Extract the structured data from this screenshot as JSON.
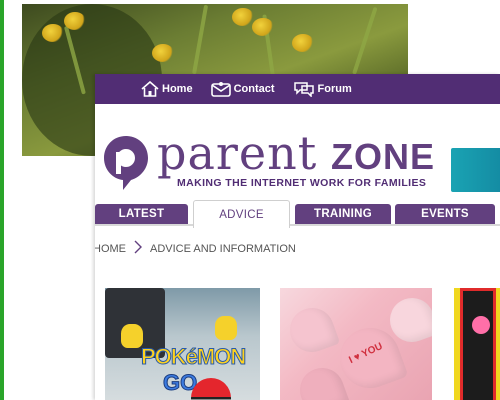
{
  "nav": {
    "home_label": "Home",
    "contact_label": "Contact",
    "forum_label": "Forum"
  },
  "brand": {
    "name_part1": "parent",
    "name_part2": "ZONE",
    "tagline": "MAKING THE INTERNET WORK FOR FAMILIES"
  },
  "tabs": [
    {
      "label": "LATEST",
      "active": false
    },
    {
      "label": "ADVICE",
      "active": true
    },
    {
      "label": "TRAINING",
      "active": false
    },
    {
      "label": "EVENTS",
      "active": false
    }
  ],
  "breadcrumb": {
    "items": [
      "HOME",
      "ADVICE AND INFORMATION"
    ]
  },
  "cards": [
    {
      "image": "pokemon-go-image",
      "text": "POKéMON"
    },
    {
      "image": "candy-hearts-image",
      "text": "I ♥ YOU"
    },
    {
      "image": "phone-app-image"
    }
  ],
  "colors": {
    "brand_purple": "#62407f",
    "nav_purple": "#512d74",
    "accent_teal": "#1aa3b3",
    "frame_green": "#2aa52a"
  },
  "icons": {
    "home": "house-icon",
    "contact": "envelope-icon",
    "forum": "speech-bubbles-icon",
    "logo": "parentzone-logo-icon",
    "breadcrumb_sep": "chevron-right-icon"
  }
}
